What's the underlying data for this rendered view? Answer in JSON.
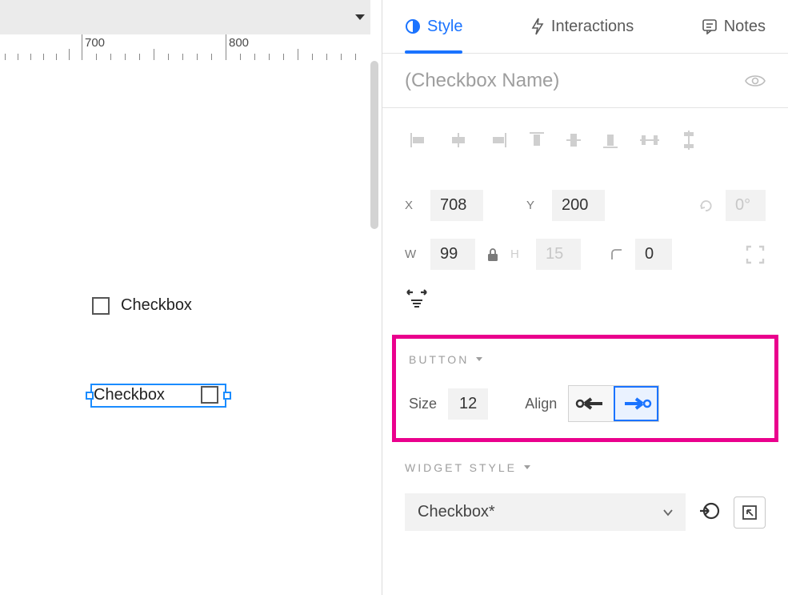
{
  "ruler": {
    "marks": [
      "700",
      "800"
    ]
  },
  "canvas": {
    "widget1_label": "Checkbox",
    "widget2_label": "Checkbox"
  },
  "tabs": {
    "style": "Style",
    "interactions": "Interactions",
    "notes": "Notes"
  },
  "name_placeholder": "(Checkbox Name)",
  "dims": {
    "x_label": "X",
    "x": "708",
    "y_label": "Y",
    "y": "200",
    "rot": "0°",
    "w_label": "W",
    "w": "99",
    "h_label": "H",
    "h": "15",
    "radius": "0"
  },
  "button_section": {
    "title": "BUTTON",
    "size_label": "Size",
    "size": "12",
    "align_label": "Align"
  },
  "widget_style": {
    "title": "WIDGET STYLE",
    "selected": "Checkbox*"
  }
}
